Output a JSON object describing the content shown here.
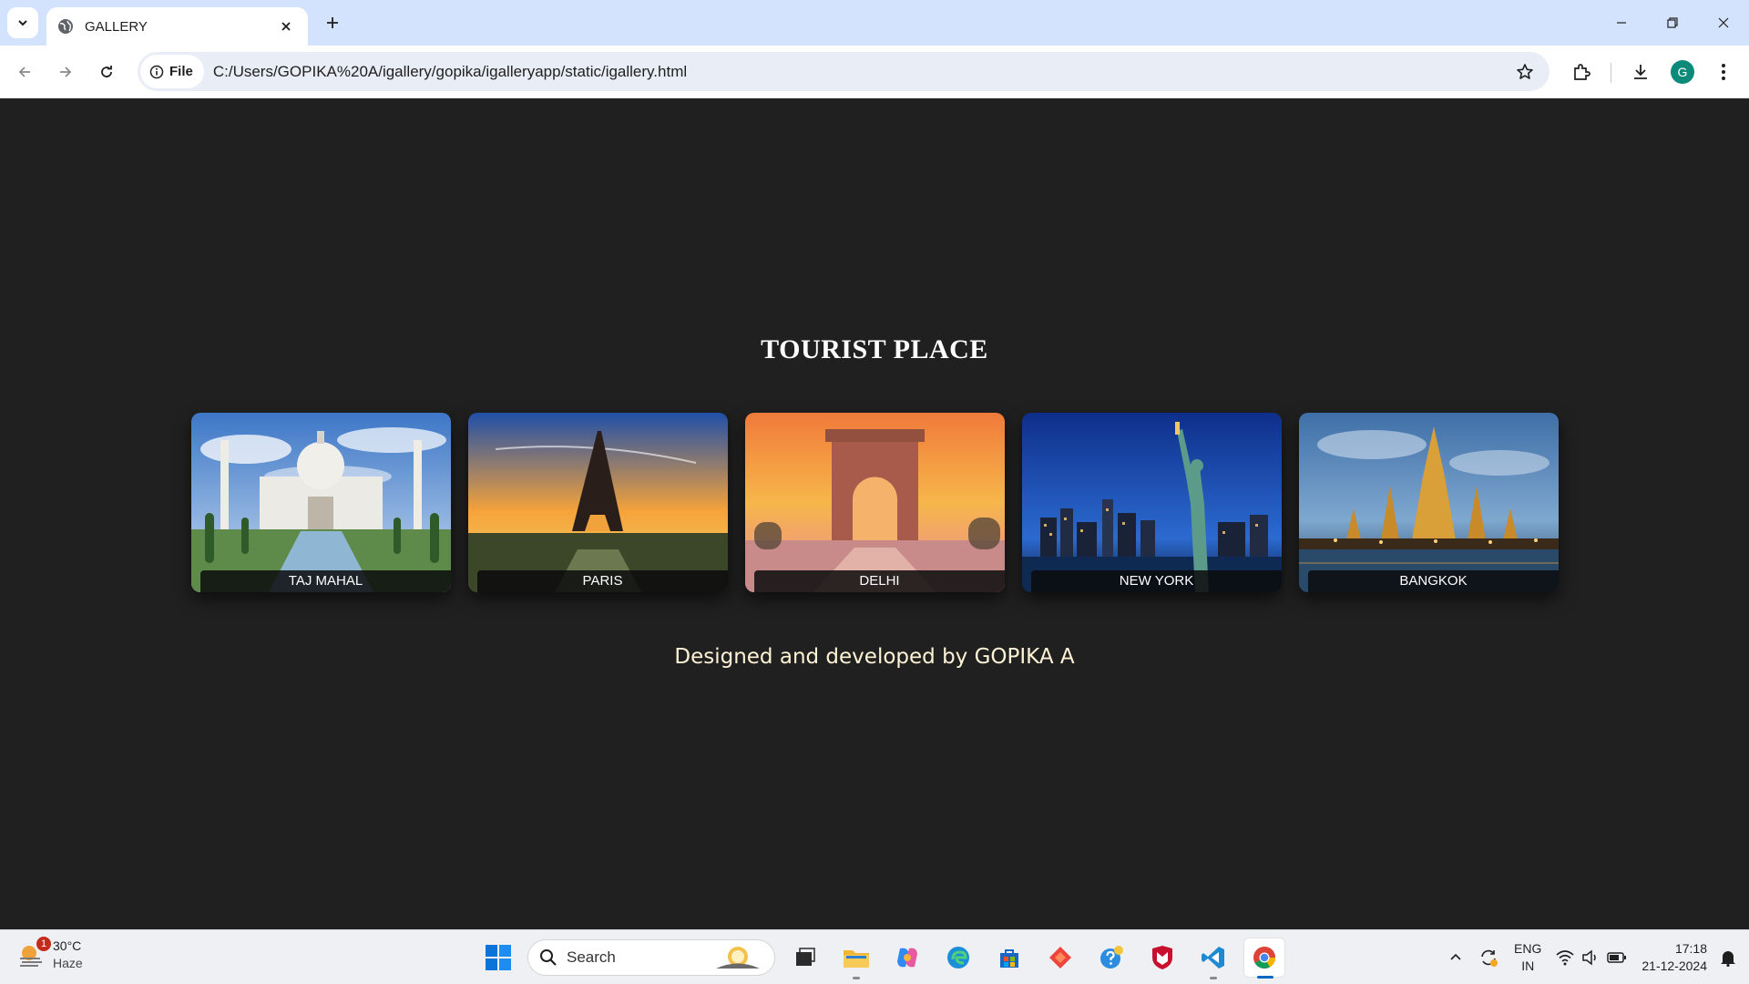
{
  "browser": {
    "tab": {
      "title": "GALLERY"
    },
    "omnibox": {
      "chip_label": "File",
      "url": "C:/Users/GOPIKA%20A/igallery/gopika/igalleryapp/static/igallery.html"
    },
    "profile_initial": "G"
  },
  "page": {
    "heading": "TOURIST PLACE",
    "gallery": [
      {
        "caption": "TAJ MAHAL"
      },
      {
        "caption": "PARIS"
      },
      {
        "caption": "DELHI"
      },
      {
        "caption": "NEW YORK"
      },
      {
        "caption": "BANGKOK"
      }
    ],
    "credit": "Designed and developed by GOPIKA A"
  },
  "taskbar": {
    "weather": {
      "temp": "30°C",
      "condition": "Haze",
      "badge": "1"
    },
    "search_placeholder": "Search",
    "language": {
      "line1": "ENG",
      "line2": "IN"
    },
    "clock": {
      "time": "17:18",
      "date": "21-12-2024"
    }
  },
  "colors": {
    "page_bg": "#202020",
    "tabstrip_bg": "#d3e3fd",
    "credit_text": "#fff3d6"
  }
}
